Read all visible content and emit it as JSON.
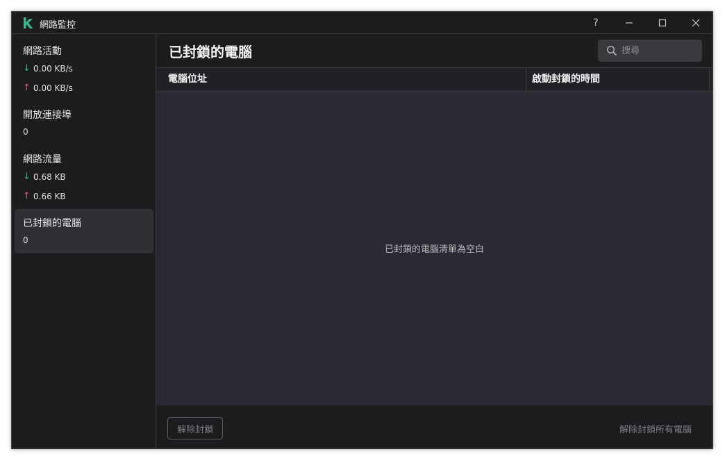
{
  "window": {
    "title": "網路監控",
    "help_label": "?",
    "minimize_label": "—",
    "maximize_label": "☐",
    "close_label": "✕"
  },
  "sidebar": {
    "network_activity": {
      "title": "網路活動",
      "download": "0.00 KB/s",
      "upload": "0.00 KB/s"
    },
    "open_ports": {
      "title": "開放連接埠",
      "value": "0"
    },
    "network_traffic": {
      "title": "網路流量",
      "download": "0.68 KB",
      "upload": "0.66 KB"
    },
    "blocked_computers": {
      "title": "已封鎖的電腦",
      "value": "0"
    },
    "selected": "blocked_computers"
  },
  "main": {
    "title": "已封鎖的電腦",
    "search": {
      "placeholder": "搜尋",
      "value": ""
    },
    "columns": [
      "電腦位址",
      "啟動封鎖的時間"
    ],
    "rows": [],
    "empty_message": "已封鎖的電腦清單為空白",
    "unblock_button": "解除封鎖",
    "unblock_all_button": "解除封鎖所有電腦"
  },
  "icons": {
    "logo": "kaspersky-k-icon",
    "download": "arrow-down-icon",
    "upload": "arrow-up-icon",
    "search": "search-icon"
  },
  "colors": {
    "accent": "#3bb58b",
    "download": "#3bb58b",
    "upload": "#e0545c",
    "background": "#1c1c1e"
  }
}
